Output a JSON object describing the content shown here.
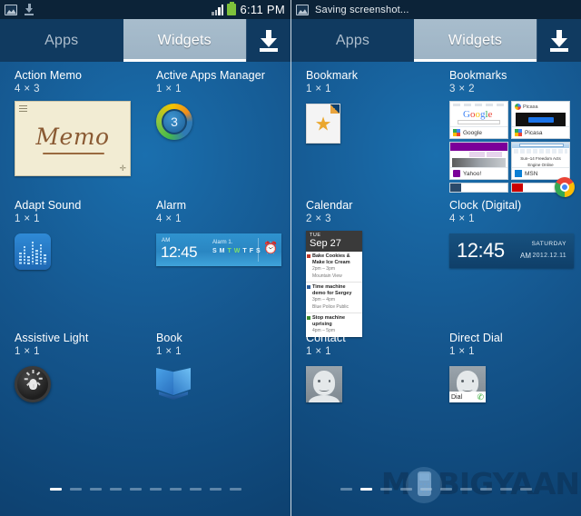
{
  "panels": [
    {
      "id": "left",
      "statusbar": {
        "icons": [
          "image-icon",
          "download-icon"
        ],
        "notification": "",
        "signal": "signal-icon",
        "battery": "battery-icon",
        "time": "6:11 PM"
      },
      "tabs": [
        {
          "label": "Apps",
          "active": false
        },
        {
          "label": "Widgets",
          "active": true
        }
      ],
      "download_button": "download-icon",
      "widgets": [
        {
          "title": "Action Memo",
          "size": "4 × 3",
          "preview": "memo",
          "memo_text": "Memo"
        },
        {
          "title": "Active Apps Manager",
          "size": "1 × 1",
          "preview": "ring",
          "count": "3"
        },
        {
          "title": "Adapt Sound",
          "size": "1 × 1",
          "preview": "equalizer"
        },
        {
          "title": "Alarm",
          "size": "4 × 1",
          "preview": "alarm",
          "alarm": {
            "ampm": "AM",
            "time": "12:45",
            "label": "Alarm 1.",
            "days": [
              "S",
              "M",
              "T",
              "W",
              "T",
              "F",
              "S"
            ],
            "active_days": [
              2,
              3
            ]
          }
        },
        {
          "title": "Assistive Light",
          "size": "1 × 1",
          "preview": "flashlight"
        },
        {
          "title": "Book",
          "size": "1 × 1",
          "preview": "book"
        }
      ],
      "pager": {
        "count": 10,
        "active": 0
      }
    },
    {
      "id": "right",
      "statusbar": {
        "icons": [
          "image-icon"
        ],
        "notification": "Saving screenshot...",
        "signal": "",
        "battery": "",
        "time": ""
      },
      "tabs": [
        {
          "label": "Apps",
          "active": false
        },
        {
          "label": "Widgets",
          "active": true
        }
      ],
      "download_button": "download-icon",
      "widgets": [
        {
          "title": "Bookmark",
          "size": "1 × 1",
          "preview": "bookmark-star"
        },
        {
          "title": "Bookmarks",
          "size": "3 × 2",
          "preview": "bookmarks-grid",
          "bookmarks": [
            "Google",
            "Picasa",
            "Yahoo!",
            "MSN"
          ]
        },
        {
          "title": "Calendar",
          "size": "2 × 3",
          "preview": "calendar",
          "calendar": {
            "dow": "TUE",
            "date": "Sep 27",
            "events": [
              {
                "title": "Bake Cookies & Make Ice Cream",
                "time": "2pm – 3pm",
                "place": "Mountain View",
                "color": "#c0392b"
              },
              {
                "title": "Time machine demo for Sergey",
                "time": "3pm – 4pm",
                "place": "Blue Police Public",
                "color": "#2c5f9e"
              },
              {
                "title": "Stop machine uprising",
                "time": "4pm – 5pm",
                "place": "",
                "color": "#3c8c2f"
              }
            ]
          }
        },
        {
          "title": "Clock (Digital)",
          "size": "4 × 1",
          "preview": "clock-digital",
          "clock": {
            "time": "12:45",
            "ampm": "AM",
            "weekday": "SATURDAY",
            "date": "2012.12.11"
          }
        },
        {
          "title": "Contact",
          "size": "1 × 1",
          "preview": "contact-avatar"
        },
        {
          "title": "Direct Dial",
          "size": "1 × 1",
          "preview": "direct-dial",
          "dial_label": "Dial"
        }
      ],
      "pager": {
        "count": 10,
        "active": 1
      },
      "watermark": {
        "before": "M",
        "after": "BIGYAAN"
      }
    }
  ],
  "colors": {
    "background_top": "#1a6fae",
    "background_bottom": "#0d3f6d",
    "statusbar": "#0c2338",
    "tab_active": "#a8bdcd",
    "accent_white": "#ffffff"
  }
}
